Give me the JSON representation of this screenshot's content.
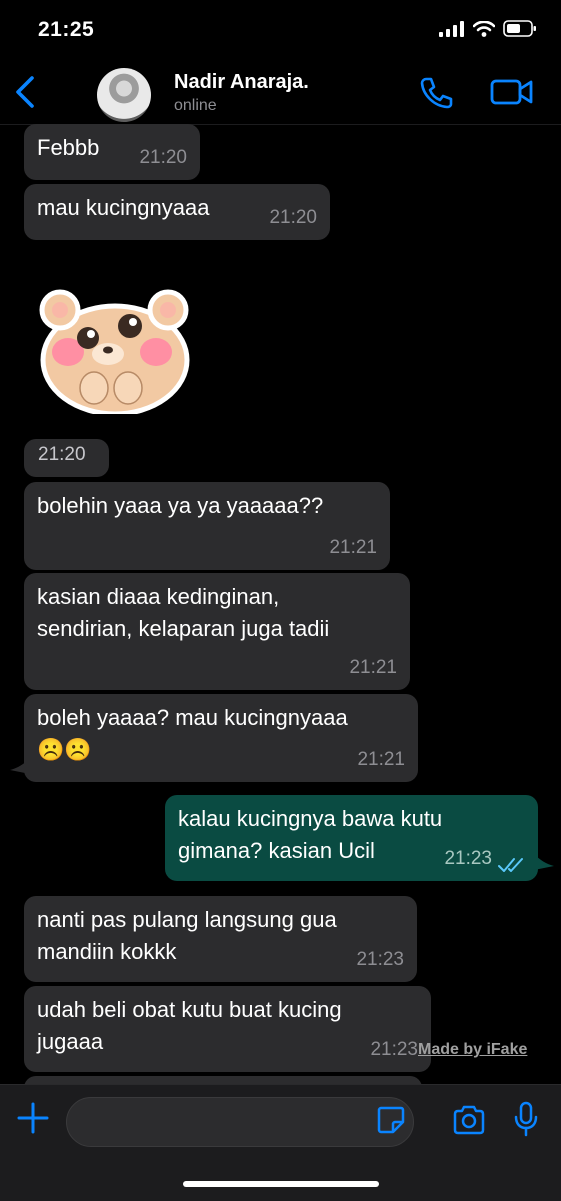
{
  "status_bar": {
    "time": "21:25"
  },
  "header": {
    "contact_name": "Nadir Anaraja.",
    "presence": "online"
  },
  "messages": [
    {
      "text": "Febbb",
      "time": "21:20"
    },
    {
      "text": "mau kucingnyaaa",
      "time": "21:20"
    },
    {
      "time": "21:20"
    },
    {
      "text": "bolehin yaaa ya ya yaaaaa??",
      "time": "21:21"
    },
    {
      "text_line1": "kasian diaaa kedinginan,",
      "text_line2": "sendirian, kelaparan juga tadii",
      "time": "21:21"
    },
    {
      "text_line1": "boleh yaaaa? mau kucingnyaaa",
      "text_line2": "☹️☹️",
      "time": "21:21"
    },
    {
      "text_line1": "kalau kucingnya bawa kutu",
      "text_line2": "gimana? kasian Ucil",
      "time": "21:23"
    },
    {
      "text_line1": "nanti pas pulang langsung gua",
      "text_line2": "mandiin kokkk",
      "time": "21:23"
    },
    {
      "text_line1": "udah beli obat kutu buat kucing",
      "text_line2": "jugaaa",
      "time": "21:23"
    }
  ],
  "watermark": "Made by iFake",
  "colors": {
    "accent": "#0a84ff",
    "incoming_bubble": "#2c2c2e",
    "outgoing_bubble": "#0a4b42",
    "background": "#000000"
  }
}
